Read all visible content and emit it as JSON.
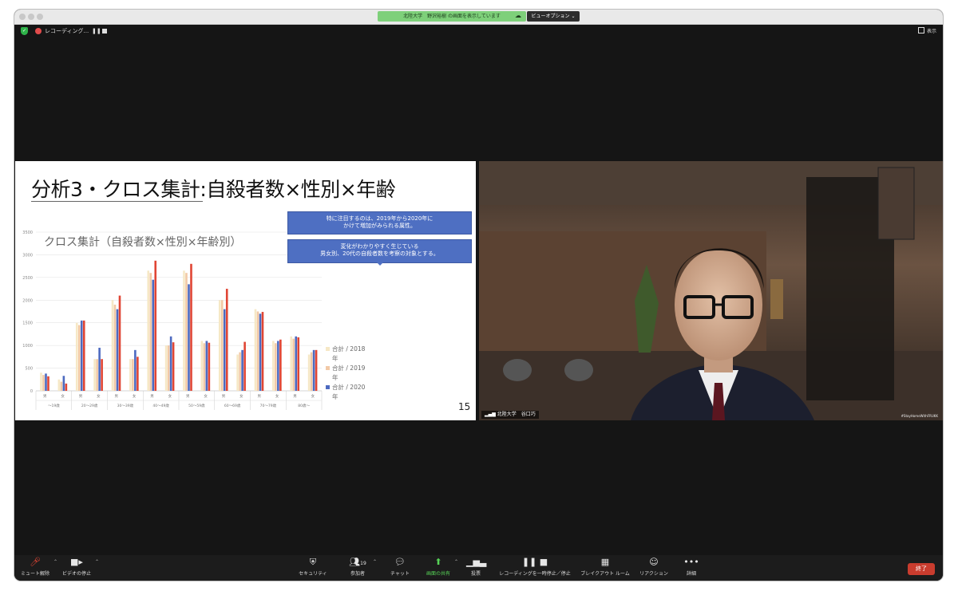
{
  "window": {
    "share_banner": "北陸大学　野沢裕樹 の画面を表示しています",
    "view_options": "ビューオプション ⌄",
    "recording_label": "レコーディング...",
    "view_toggle": "表示"
  },
  "slide": {
    "title": "分析3・クロス集計:自殺者数×性別×年齢",
    "callout1_line1": "特に注目するのは、2019年から2020年に",
    "callout1_line2": "かけて増加がみられる属性。",
    "callout2_line1": "変化がわかりやすく生じている",
    "callout2_line2": "男女別、20代の自殺者数を考察の対象とする。",
    "page_number": "15"
  },
  "chart_data": {
    "type": "bar",
    "title": "クロス集計（自殺者数×性別×年齢別）",
    "ylim": [
      0,
      3500
    ],
    "yticks": [
      "0",
      "500",
      "1000",
      "1500",
      "2000",
      "2500",
      "3000",
      "3500"
    ],
    "age_groups": [
      "〜19歳",
      "20〜29歳",
      "30〜39歳",
      "40〜49歳",
      "50〜59歳",
      "60〜69歳",
      "70〜79歳",
      "80歳〜"
    ],
    "sex_labels": [
      "男",
      "女"
    ],
    "categories": [
      "〜19歳 男",
      "〜19歳 女",
      "20〜29歳 男",
      "20〜29歳 女",
      "30〜39歳 男",
      "30〜39歳 女",
      "40〜49歳 男",
      "40〜49歳 女",
      "50〜59歳 男",
      "50〜59歳 女",
      "60〜69歳 男",
      "60〜69歳 女",
      "70〜79歳 男",
      "70〜79歳 女",
      "80歳〜 男",
      "80歳〜 女"
    ],
    "series": [
      {
        "name": "合計 / 2018年",
        "color": "#f6e8c6",
        "values": [
          400,
          250,
          1500,
          700,
          2000,
          700,
          2650,
          1000,
          2650,
          1100,
          2000,
          800,
          1800,
          1100,
          1200,
          800
        ]
      },
      {
        "name": "合計 / 2019年",
        "color": "#f2c9a6",
        "values": [
          350,
          200,
          1450,
          700,
          1900,
          700,
          2600,
          1000,
          2600,
          1050,
          2000,
          850,
          1750,
          1050,
          1150,
          850
        ]
      },
      {
        "name": "合計 / 2020年",
        "color": "#4d6ac0",
        "values": [
          380,
          330,
          1550,
          950,
          1800,
          900,
          2450,
          1200,
          2350,
          1100,
          1800,
          900,
          1700,
          1100,
          1200,
          900
        ]
      },
      {
        "name": "",
        "color": "#e04534",
        "values": [
          320,
          160,
          1550,
          700,
          2100,
          750,
          2870,
          1070,
          2800,
          1060,
          2250,
          1080,
          1740,
          1130,
          1180,
          900
        ]
      }
    ],
    "legend_position": "right",
    "grid": true
  },
  "video": {
    "participant_name": "北陸大学　谷口巧",
    "watermark": "#StayHomeWithFRUKK"
  },
  "toolbar": {
    "mute": "ミュート解除",
    "video": "ビデオの停止",
    "security": "セキュリティ",
    "participants": "参加者",
    "participants_count": "19",
    "chat": "チャット",
    "share": "画面の共有",
    "polls": "投票",
    "recording": "レコーディングを一時停止／停止",
    "breakout": "ブレイクアウト ルーム",
    "reactions": "リアクション",
    "more": "詳細",
    "end": "終了"
  }
}
